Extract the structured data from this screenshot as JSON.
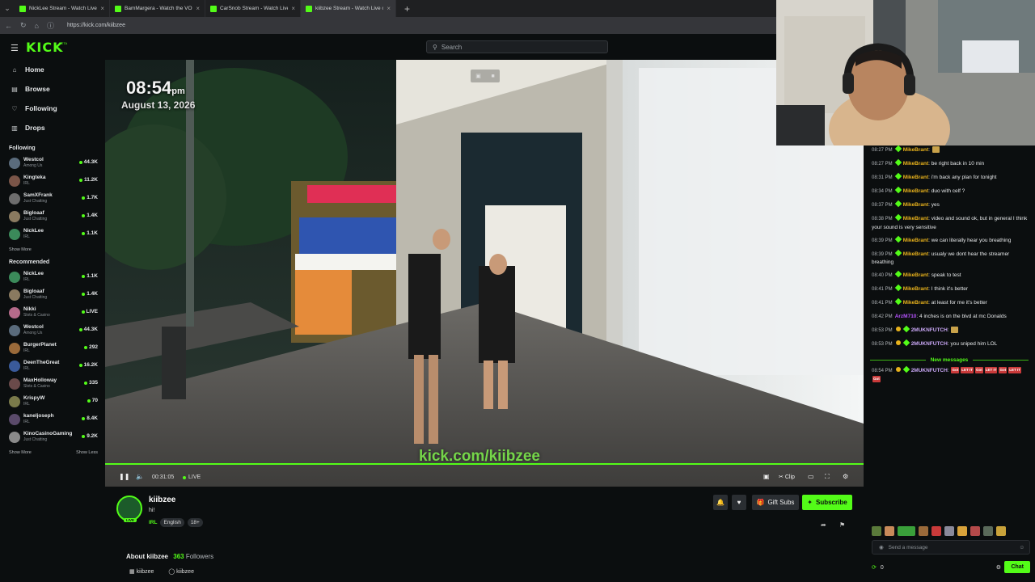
{
  "browser": {
    "tabs": [
      {
        "title": "NickLee Stream - Watch Live o",
        "active": false
      },
      {
        "title": "BamMargera - Watch the VOD on",
        "active": false
      },
      {
        "title": "CarSnob Stream - Watch Live",
        "active": false
      },
      {
        "title": "kiibzee Stream - Watch Live o",
        "active": true
      }
    ],
    "url": "https://kick.com/kiibzee"
  },
  "header": {
    "logo": "KICK",
    "logo_badge": "BETA",
    "search_placeholder": "Search"
  },
  "nav": [
    {
      "label": "Home",
      "icon": "home-icon"
    },
    {
      "label": "Browse",
      "icon": "browse-icon"
    },
    {
      "label": "Following",
      "icon": "heart-icon"
    },
    {
      "label": "Drops",
      "icon": "drops-icon"
    }
  ],
  "following": {
    "title": "Following",
    "channels": [
      {
        "name": "Westcol",
        "category": "Among Us",
        "viewers": "44.3K",
        "color": "#5a6b7c"
      },
      {
        "name": "Kingteka",
        "category": "IRL",
        "viewers": "11.2K",
        "color": "#7a5548"
      },
      {
        "name": "SamXFrank",
        "category": "Just Chatting",
        "viewers": "1.7K",
        "color": "#6d6d6d"
      },
      {
        "name": "Bigloaaf",
        "category": "Just Chatting",
        "viewers": "1.4K",
        "color": "#8a7a60"
      },
      {
        "name": "NickLee",
        "category": "IRL",
        "viewers": "1.1K",
        "color": "#3b8a5a"
      }
    ],
    "show_more": "Show More"
  },
  "recommended": {
    "title": "Recommended",
    "channels": [
      {
        "name": "NickLee",
        "category": "IRL",
        "viewers": "1.1K",
        "color": "#3b8a5a"
      },
      {
        "name": "Bigloaaf",
        "category": "Just Chatting",
        "viewers": "1.4K",
        "color": "#8a7a60"
      },
      {
        "name": "Nikki",
        "category": "Slots & Casino",
        "viewers": "LIVE",
        "color": "#b56a8a"
      },
      {
        "name": "Westcol",
        "category": "Among Us",
        "viewers": "44.3K",
        "color": "#5a6b7c"
      },
      {
        "name": "BurgerPlanet",
        "category": "IRL",
        "viewers": "292",
        "color": "#9a6a3a"
      },
      {
        "name": "DeenTheGreat",
        "category": "IRL",
        "viewers": "16.2K",
        "color": "#3a5a9a"
      },
      {
        "name": "MaxHolloway",
        "category": "Slots & Casino",
        "viewers": "335",
        "color": "#6a4a4a"
      },
      {
        "name": "KrispyW",
        "category": "IRL",
        "viewers": "70",
        "color": "#7a7a4a"
      },
      {
        "name": "kaneljoseph",
        "category": "IRL",
        "viewers": "8.4K",
        "color": "#5a4a6a"
      },
      {
        "name": "KinoCasinoGaming",
        "category": "Just Chatting",
        "viewers": "9.2K",
        "color": "#8a8a8a"
      }
    ],
    "show_more": "Show More",
    "show_less": "Show Less"
  },
  "player": {
    "clock_time": "08:54",
    "clock_suffix": "pm",
    "clock_date": "August 13, 2026",
    "overlay_url": "kick.com/kiibzee",
    "elapsed": "00:31:05",
    "live_label": "LIVE",
    "clip_label": "Clip",
    "progress": 1.0
  },
  "stream": {
    "name": "kiibzee",
    "title": "hi!",
    "category": "IRL",
    "tags": [
      "English",
      "18+"
    ],
    "live_badge": "LIVE",
    "gift_subs": "Gift Subs",
    "subscribe": "Subscribe",
    "about_label": "About kiibzee",
    "followers_count": "363",
    "followers_label": "Followers",
    "socials": [
      {
        "label": "kiibzee",
        "icon": "kick-social-icon"
      },
      {
        "label": "kiibzee",
        "icon": "instagram-icon"
      }
    ]
  },
  "chat": {
    "user_colors": {
      "MikeBrant": "#e8b21c",
      "ArzM710": "#b553fc",
      "2MUKNFUTCH": "#c9a7f5"
    },
    "messages": [
      {
        "time": "08:27 PM",
        "user": "MikeBrant",
        "text": "",
        "badge": "green"
      },
      {
        "time": "08:27 PM",
        "user": "MikeBrant",
        "text": "be right back in 10 min",
        "badge": "green"
      },
      {
        "time": "08:31 PM",
        "user": "MikeBrant",
        "text": "i'm back any plan for tonight",
        "badge": "green"
      },
      {
        "time": "08:34 PM",
        "user": "MikeBrant",
        "text": "duo with celf ?",
        "badge": "green"
      },
      {
        "time": "08:37 PM",
        "user": "MikeBrant",
        "text": "yes",
        "badge": "green"
      },
      {
        "time": "08:38 PM",
        "user": "MikeBrant",
        "text": "video and sound ok, but in general I think your sound is very sensitive",
        "badge": "green"
      },
      {
        "time": "08:39 PM",
        "user": "MikeBrant",
        "text": "we can literally hear you breathing",
        "badge": "green"
      },
      {
        "time": "08:39 PM",
        "user": "MikeBrant",
        "text": "usualy we dont hear the streamer breathing",
        "badge": "green"
      },
      {
        "time": "08:40 PM",
        "user": "MikeBrant",
        "text": "speak to test",
        "badge": "green"
      },
      {
        "time": "08:41 PM",
        "user": "MikeBrant",
        "text": "I think it's better",
        "badge": "green"
      },
      {
        "time": "08:41 PM",
        "user": "MikeBrant",
        "text": "at least for me it's better",
        "badge": "green"
      },
      {
        "time": "08:42 PM",
        "user": "ArzM710",
        "text": "4 inches is on the blvd at mc Donalds",
        "badge": "none"
      },
      {
        "time": "08:53 PM",
        "user": "2MUKNFUTCH",
        "text": "",
        "badge": "gold"
      },
      {
        "time": "08:53 PM",
        "user": "2MUKNFUTCH",
        "text": "you sniped him LOL",
        "badge": "gold"
      }
    ],
    "new_messages_label": "New messages",
    "last_message": {
      "time": "08:54 PM",
      "user": "2MUKNFUTCH",
      "emotes": [
        "Got",
        "LET IT",
        "Got",
        "LET IT",
        "Got",
        "LET IT",
        "Got"
      ]
    },
    "input_placeholder": "Send a message",
    "points": "0",
    "send_label": "Chat"
  },
  "colors": {
    "accent": "#53fc18",
    "bg": "#0b0e0f"
  }
}
